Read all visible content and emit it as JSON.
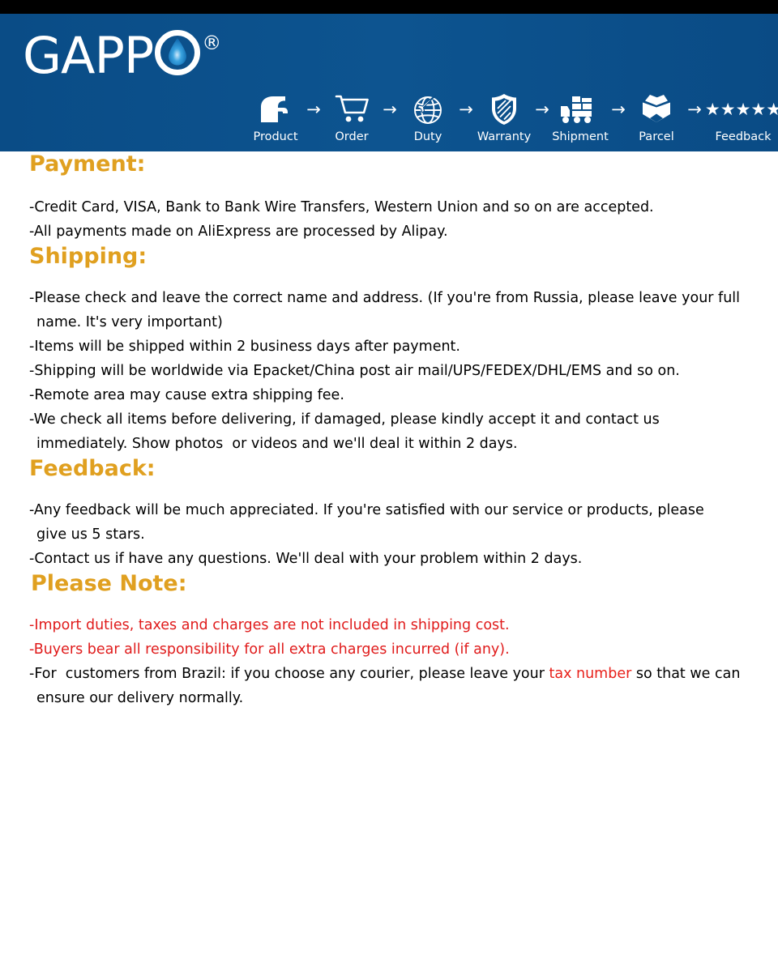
{
  "colors": {
    "header_blue": "#0a4f8a",
    "heading_gold": "#e0a020",
    "alert_red": "#e01b1b",
    "top_band_black": "#000000",
    "body_text": "#000000"
  },
  "header": {
    "brand": {
      "text": "GAPP",
      "o_letter_icon": "water-drop-in-ring",
      "registered_mark": "®"
    },
    "steps": [
      {
        "label": "Product",
        "icon": "faucet-icon"
      },
      {
        "label": "Order",
        "icon": "shopping-cart-icon"
      },
      {
        "label": "Duty",
        "icon": "globe-airplane-icon"
      },
      {
        "label": "Warranty",
        "icon": "shield-icon"
      },
      {
        "label": "Shipment",
        "icon": "delivery-truck-icon"
      },
      {
        "label": "Parcel",
        "icon": "open-box-icon"
      },
      {
        "label": "Feedback",
        "icon": "five-stars-icon",
        "stars": "★★★★★"
      }
    ],
    "arrow_glyph": "→"
  },
  "sections": {
    "payment": {
      "title": "Payment:",
      "lines": [
        {
          "text": "-Credit Card, VISA, Bank to Bank Wire Transfers, Western Union and so on are accepted.",
          "indent": false,
          "color": "black"
        },
        {
          "text": "-All payments made on AliExpress are processed by Alipay.",
          "indent": false,
          "color": "black"
        }
      ]
    },
    "shipping": {
      "title": "Shipping:",
      "lines": [
        {
          "text": "-Please check and leave the correct name and address. (If you're from Russia, please leave your full",
          "indent": false,
          "color": "black"
        },
        {
          "text": "name. It's very important)",
          "indent": true,
          "color": "black"
        },
        {
          "text": "-Items will be shipped within 2 business days after payment.",
          "indent": false,
          "color": "black"
        },
        {
          "text": "-Shipping will be worldwide via Epacket/China post air mail/UPS/FEDEX/DHL/EMS and so on.",
          "indent": false,
          "color": "black"
        },
        {
          "text": "-Remote area may cause extra shipping fee.",
          "indent": false,
          "color": "black"
        },
        {
          "text": "-We check all items before delivering, if damaged, please kindly accept it and contact us",
          "indent": false,
          "color": "black"
        },
        {
          "text": "immediately. Show photos  or videos and we'll deal it within 2 days.",
          "indent": true,
          "color": "black"
        }
      ]
    },
    "feedback": {
      "title": "Feedback:",
      "lines": [
        {
          "text": "-Any feedback will be much appreciated. If you're satisfied with our service or products, please",
          "indent": false,
          "color": "black"
        },
        {
          "text": "give us 5 stars.",
          "indent": true,
          "color": "black"
        },
        {
          "text": "-Contact us if have any questions. We'll deal with your problem within 2 days.",
          "indent": false,
          "color": "black"
        }
      ]
    },
    "please_note": {
      "title": "Please Note:",
      "lines": [
        {
          "text": "-Import duties, taxes and charges are not included in shipping cost.",
          "indent": false,
          "color": "red"
        },
        {
          "text": "-Buyers bear all responsibility for all extra charges incurred (if any).",
          "indent": false,
          "color": "red"
        }
      ],
      "brazil_line": {
        "before": "-For  customers from Brazil: if you choose any courier, please leave your ",
        "highlight": "tax number",
        "after": " so that we can"
      },
      "brazil_line_2": "ensure our delivery normally."
    }
  }
}
